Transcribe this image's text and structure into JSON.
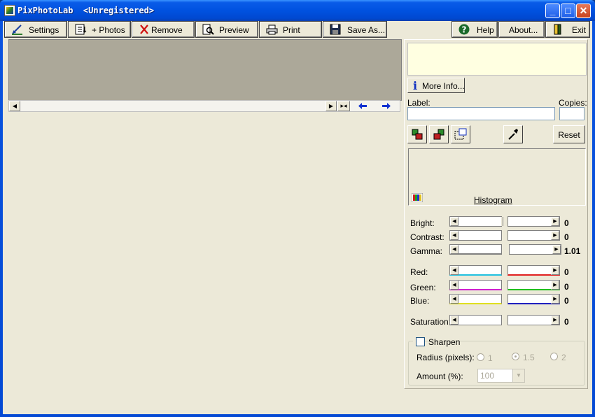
{
  "window": {
    "title": "PixPhotoLab  <Unregistered>",
    "controls": {
      "minimize": "_",
      "maximize": "□",
      "close": "✕"
    }
  },
  "toolbar": {
    "settings": "Settings",
    "add_photos": "+ Photos",
    "remove": "Remove",
    "preview": "Preview",
    "print": "Print",
    "save_as": "Save As...",
    "help": "Help",
    "about": "About...",
    "exit": "Exit"
  },
  "panel": {
    "more_info": "More Info...",
    "label_caption": "Label:",
    "label_value": "",
    "copies_caption": "Copies:",
    "copies_value": "",
    "reset": "Reset",
    "histogram": "Histogram"
  },
  "adjustments": {
    "bright": {
      "label": "Bright:",
      "value": "0"
    },
    "contrast": {
      "label": "Contrast:",
      "value": "0"
    },
    "gamma": {
      "label": "Gamma:",
      "value": "1.01"
    },
    "red": {
      "label": "Red:",
      "value": "0"
    },
    "green": {
      "label": "Green:",
      "value": "0"
    },
    "blue": {
      "label": "Blue:",
      "value": "0"
    },
    "saturation": {
      "label": "Saturation:",
      "value": "0"
    }
  },
  "sharpen": {
    "label": "Sharpen",
    "checked": false,
    "radius_label": "Radius (pixels):",
    "radius_options": [
      "1",
      "1.5",
      "2"
    ],
    "radius_selected": "1.5",
    "amount_label": "Amount (%):",
    "amount_value": "100"
  },
  "colors": {
    "title_bar": "#0a5ce8",
    "face": "#ece9d8",
    "gallery": "#aca899",
    "info_box": "#ffffe1",
    "red_channel": "#e02020",
    "cyan_channel": "#20c0e0",
    "green_channel": "#20c020",
    "magenta_channel": "#d020d0",
    "blue_channel": "#2020c0",
    "yellow_channel": "#e0e020"
  }
}
